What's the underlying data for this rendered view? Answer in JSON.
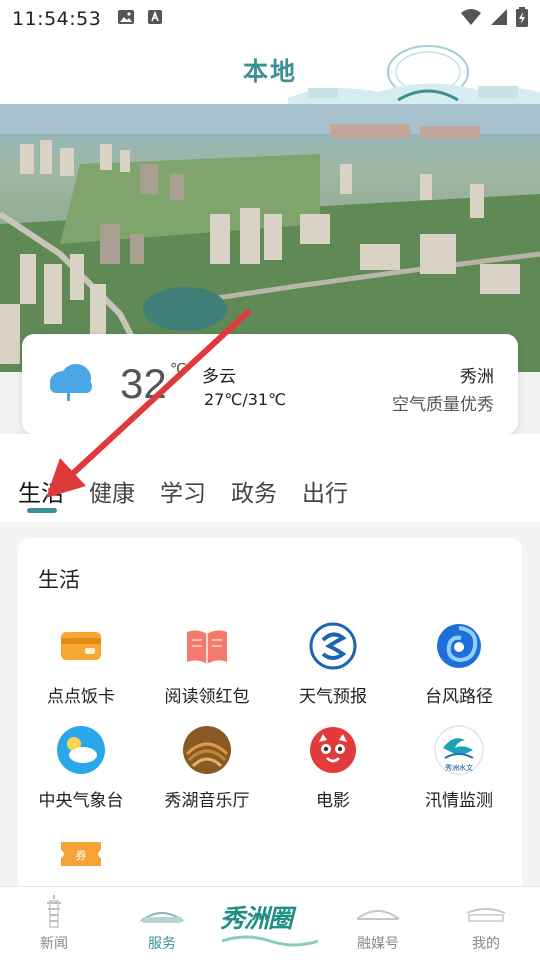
{
  "status": {
    "time": "11:54:53"
  },
  "header": {
    "title": "本地"
  },
  "weather": {
    "temperature": "32",
    "unit": "℃",
    "condition": "多云",
    "range": "27℃/31℃",
    "location": "秀洲",
    "air_quality": "空气质量优秀"
  },
  "tabs": [
    {
      "label": "生活",
      "active": true
    },
    {
      "label": "健康",
      "active": false
    },
    {
      "label": "学习",
      "active": false
    },
    {
      "label": "政务",
      "active": false
    },
    {
      "label": "出行",
      "active": false
    }
  ],
  "panel": {
    "title": "生活",
    "services": [
      {
        "label": "点点饭卡",
        "icon": "meal-card-icon"
      },
      {
        "label": "阅读领红包",
        "icon": "book-icon"
      },
      {
        "label": "天气预报",
        "icon": "weather-forecast-icon"
      },
      {
        "label": "台风路径",
        "icon": "typhoon-icon"
      },
      {
        "label": "中央气象台",
        "icon": "weather-station-icon"
      },
      {
        "label": "秀湖音乐厅",
        "icon": "concert-hall-icon"
      },
      {
        "label": "电影",
        "icon": "movie-cat-icon"
      },
      {
        "label": "汛情监测",
        "icon": "flood-monitor-icon"
      },
      {
        "label": "",
        "icon": "coupon-icon"
      }
    ],
    "flood_logo_text": "秀洲水文",
    "coupon_text": "券"
  },
  "bottom_nav": {
    "items": [
      {
        "label": "新闻",
        "icon": "pagoda-icon",
        "active": false
      },
      {
        "label": "服务",
        "icon": "building-icon",
        "active": true
      },
      {
        "label": "融媒号",
        "icon": "bridge-icon",
        "active": false
      },
      {
        "label": "我的",
        "icon": "hall-icon",
        "active": false
      }
    ],
    "brand": "秀洲圈"
  },
  "colors": {
    "accent": "#3b8f97",
    "brand": "#1f8f83",
    "annotation_arrow": "#e0393b"
  }
}
